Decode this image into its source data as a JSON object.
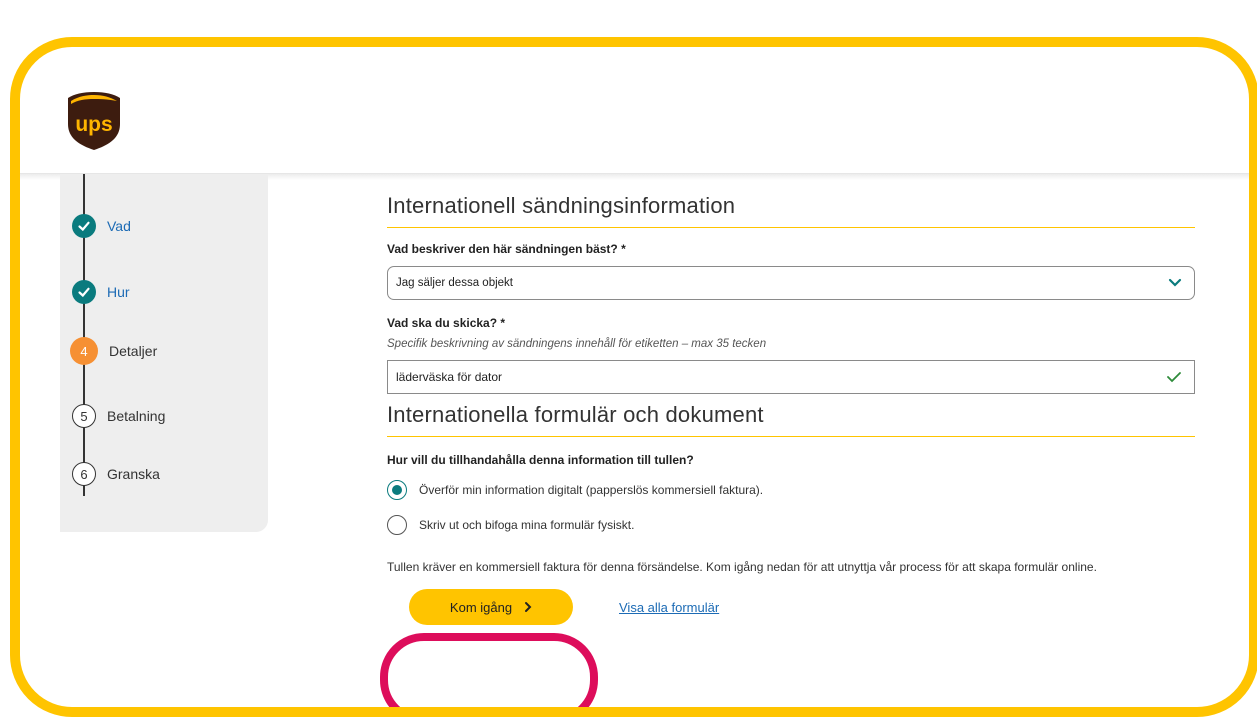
{
  "brand": {
    "logo_text": "ups",
    "accent": "#ffc400",
    "teal": "#0a7b7e",
    "orange": "#f69033",
    "highlight": "#dd0d5b"
  },
  "stepper": {
    "items": [
      {
        "number": "",
        "label": "Vad",
        "state": "done"
      },
      {
        "number": "",
        "label": "Hur",
        "state": "done"
      },
      {
        "number": "4",
        "label": "Detaljer",
        "state": "active"
      },
      {
        "number": "5",
        "label": "Betalning",
        "state": "todo"
      },
      {
        "number": "6",
        "label": "Granska",
        "state": "todo"
      }
    ]
  },
  "shipment_section": {
    "title": "Internationell sändningsinformation",
    "describe_label": "Vad beskriver den här sändningen bäst? *",
    "describe_value": "Jag säljer dessa objekt",
    "what_label": "Vad ska du skicka? *",
    "what_helper": "Specifik beskrivning av sändningens innehåll för etiketten – max 35 tecken",
    "what_value": "läderväska för dator"
  },
  "forms_section": {
    "title": "Internationella formulär och dokument",
    "question": "Hur vill du tillhandahålla denna information till tullen?",
    "options": [
      {
        "label": "Överför min information digitalt (papperslös kommersiell faktura).",
        "checked": true
      },
      {
        "label": "Skriv ut och bifoga mina formulär fysiskt.",
        "checked": false
      }
    ],
    "info_text": "Tullen kräver en kommersiell faktura för denna försändelse. Kom igång nedan för att utnyttja vår process för att skapa formulär online.",
    "primary_button": "Kom igång",
    "link_text": "Visa alla formulär"
  }
}
